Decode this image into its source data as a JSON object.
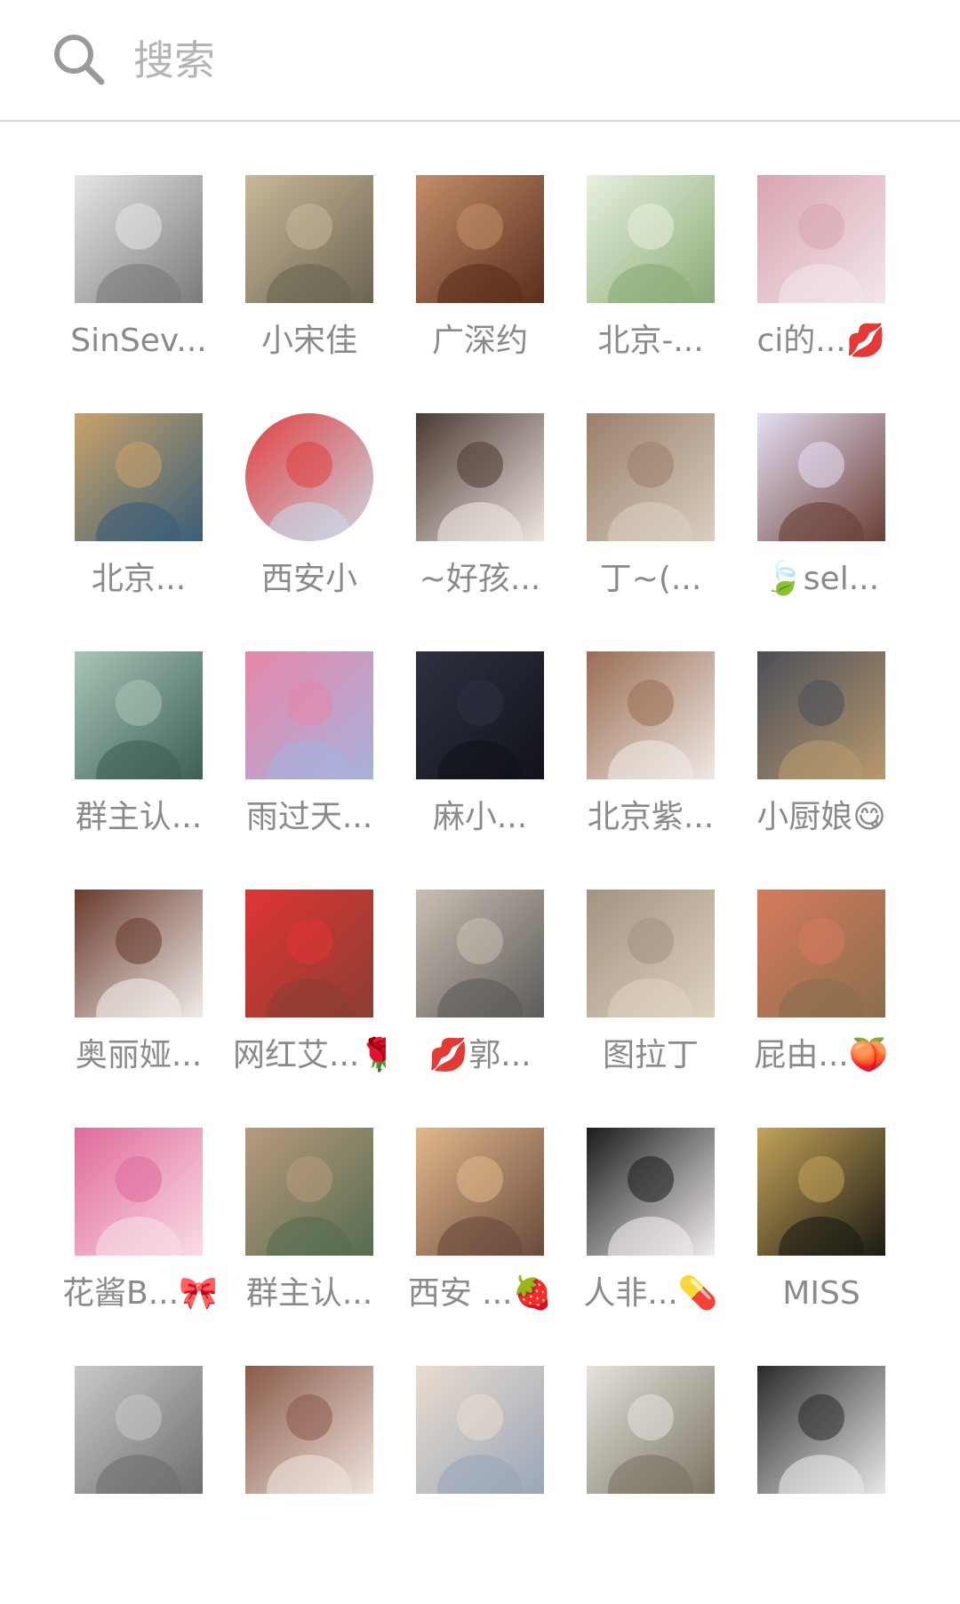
{
  "search": {
    "placeholder": "搜索",
    "icon": "search-icon"
  },
  "contacts": [
    {
      "name": "SinSev...",
      "color": "#7a7a7a",
      "accent": "#e6e6e6"
    },
    {
      "name": "小宋佳",
      "color": "#6b6550",
      "accent": "#c9b89a"
    },
    {
      "name": "广深约",
      "color": "#5a2e1c",
      "accent": "#c38e6a"
    },
    {
      "name": "北京-...",
      "color": "#8bab76",
      "accent": "#e8f0df"
    },
    {
      "name": "ci的...💋",
      "color": "#f2e6e9",
      "accent": "#d9a4b0"
    },
    {
      "name": "北京...",
      "color": "#3a5e78",
      "accent": "#c9a36a"
    },
    {
      "name": "西安小",
      "color": "#cbd7e6",
      "accent": "#e04040",
      "round": true
    },
    {
      "name": "~好孩...",
      "color": "#efe6e2",
      "accent": "#4a3a32"
    },
    {
      "name": "丁~(...",
      "color": "#d9cfc0",
      "accent": "#9a7f6a"
    },
    {
      "name": "🍃sel...",
      "color": "#6b3f35",
      "accent": "#e5e0f5"
    },
    {
      "name": "群主认...",
      "color": "#3c5f56",
      "accent": "#a9c5b6"
    },
    {
      "name": "雨过天...",
      "color": "#a7b1dd",
      "accent": "#e887a8"
    },
    {
      "name": "麻小...",
      "color": "#11121a",
      "accent": "#2e3240"
    },
    {
      "name": "北京紫...",
      "color": "#efe9e4",
      "accent": "#9a6d54"
    },
    {
      "name": "小厨娘😋",
      "color": "#b8996e",
      "accent": "#4b4e57"
    },
    {
      "name": "奥丽娅...",
      "color": "#f0ece9",
      "accent": "#6a3a2c"
    },
    {
      "name": "网红艾...🌹",
      "color": "#8a3e32",
      "accent": "#e03535"
    },
    {
      "name": "💋郭...",
      "color": "#5e5a58",
      "accent": "#c9bfb4"
    },
    {
      "name": "图拉丁",
      "color": "#ddd2c0",
      "accent": "#a39381"
    },
    {
      "name": "屁由...🍑",
      "color": "#8a6e4e",
      "accent": "#d77a5d"
    },
    {
      "name": "花酱B...🎀",
      "color": "#f9dce7",
      "accent": "#e06a9a"
    },
    {
      "name": "群主认...",
      "color": "#566c4e",
      "accent": "#b89a7e"
    },
    {
      "name": "西安 ...🍓",
      "color": "#6a4a3c",
      "accent": "#e2b88c"
    },
    {
      "name": "人非...💊",
      "color": "#f3eeee",
      "accent": "#1b1b1b"
    },
    {
      "name": "MISS",
      "color": "#1b1a12",
      "accent": "#c4a35a"
    },
    {
      "name": "",
      "color": "#6e6e6e",
      "accent": "#c9c9c9"
    },
    {
      "name": "",
      "color": "#efe3de",
      "accent": "#8a5a48"
    },
    {
      "name": "",
      "color": "#9aa6b8",
      "accent": "#e9dccf"
    },
    {
      "name": "",
      "color": "#7a7564",
      "accent": "#e6e1dc"
    },
    {
      "name": "",
      "color": "#e9e9e9",
      "accent": "#2a2a2a"
    }
  ]
}
